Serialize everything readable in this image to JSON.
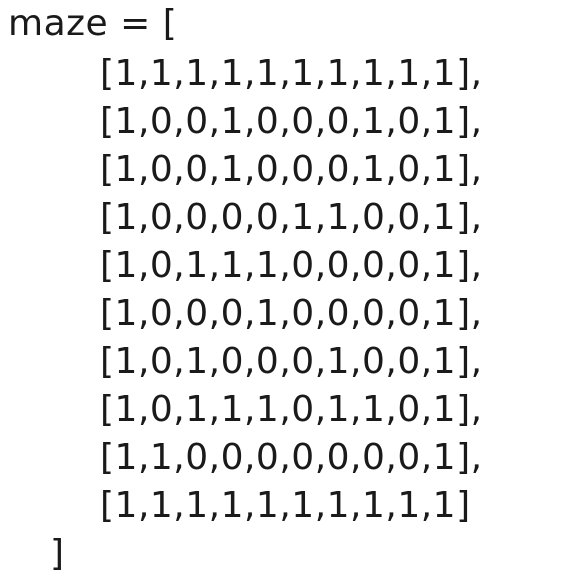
{
  "code": {
    "opening": "maze = [",
    "rows": [
      "[1,1,1,1,1,1,1,1,1,1],",
      "[1,0,0,1,0,0,0,1,0,1],",
      "[1,0,0,1,0,0,0,1,0,1],",
      "[1,0,0,0,0,1,1,0,0,1],",
      "[1,0,1,1,1,0,0,0,0,1],",
      "[1,0,0,0,1,0,0,0,0,1],",
      "[1,0,1,0,0,0,1,0,0,1],",
      "[1,0,1,1,1,0,1,1,0,1],",
      "[1,1,0,0,0,0,0,0,0,1],",
      "[1,1,1,1,1,1,1,1,1,1]"
    ],
    "closing": "]"
  }
}
